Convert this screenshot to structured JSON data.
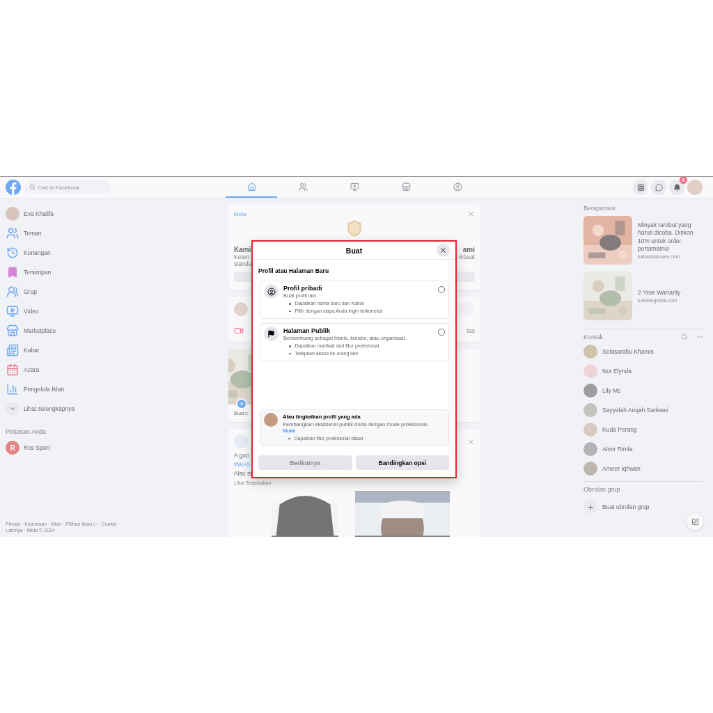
{
  "top_bar": {
    "search": {
      "placeholder": "Cari di Facebook"
    },
    "nav_tabs": [
      {
        "selected": true
      },
      {
        "selected": false
      },
      {
        "selected": false
      },
      {
        "selected": false
      },
      {
        "selected": false
      }
    ],
    "notification_badge": "6"
  },
  "left_sidebar": {
    "profile_name": "Eva Khalifa",
    "items": [
      "Teman",
      "Kenangan",
      "Tersimpan",
      "Grup",
      "Video",
      "Marketplace",
      "Kabar",
      "Acara",
      "Pengelola Iklan"
    ],
    "see_more": "Lihat selengkapnya",
    "shortcuts_title": "Pintasan Anda",
    "shortcuts": [
      {
        "initial": "R",
        "name": "Ros Sport"
      }
    ],
    "footer": [
      "Privasi · Ketentuan · Iklan · Pilihan Iklan ▷ · Cookie ·",
      "Lainnya · Meta © 2024"
    ]
  },
  "feed": {
    "meta_card": {
      "brand": "Meta",
      "heading_left": "Kami",
      "heading_right": "ami",
      "body_left": [
        "Keten",
        "standa"
      ],
      "body_right": [
        "mbuat"
      ]
    },
    "composer": {
      "action_right": "tas"
    },
    "stories": {
      "create_label": "Buat c"
    },
    "post": {
      "lines": [
        {
          "text": "A goo",
          "kind": "plain"
        },
        {
          "text": "#WAS",
          "kind": "link"
        },
        {
          "text": "Also st",
          "kind": "plain"
        }
      ],
      "see_translation": "Lihat Terjemahan"
    }
  },
  "right_sidebar": {
    "sponsored_title": "Bersponsor",
    "ads": [
      {
        "text": "Minyak rambut yang harus dicoba. Diskon 10% untuk order pertamamu!",
        "domain": "kahariskincare.com"
      },
      {
        "text": "2-Year Warranty",
        "domain": "koloresglobal.com"
      }
    ],
    "contacts_title": "Kontak",
    "contacts": [
      "Selasarabu Khamis",
      "Nur Elynda",
      "Lily Mc",
      "Sayyidah Ariqah Sarkawi",
      "Kuda Perang",
      "Almir Rimla",
      "Ameer Iqhwan"
    ],
    "group_chat_title": "Obrolan grup",
    "create_group": "Buat obrolan grup"
  },
  "modal": {
    "title": "Buat",
    "section_title": "Profil atau Halaman Baru",
    "options": [
      {
        "title": "Profil pribadi",
        "subtitle": "Buat profil lain.",
        "bullets": [
          "Dapatkan nama baru dan Kabar",
          "Pilih dengan siapa Anda ingin terkoneksi"
        ],
        "selected": false
      },
      {
        "title": "Halaman Publik",
        "subtitle": "Berkembang sebagai bisnis, kreator, atau organisasi.",
        "bullets": [
          "Dapatkan manfaat dari fitur profesional",
          "Tetapkan akses ke orang lain"
        ],
        "selected": false
      }
    ],
    "upgrade": {
      "title": "Atau tingkatkan profil yang ada",
      "text": "Kembangkan eksistensi publik Anda dengan mode profesional.",
      "link": "Mulai",
      "bullets": [
        "Dapatkan fitur profesional dasar"
      ]
    },
    "buttons": [
      {
        "label": "Berikutnya",
        "disabled": true
      },
      {
        "label": "Bandingkan opsi",
        "disabled": false
      }
    ]
  }
}
